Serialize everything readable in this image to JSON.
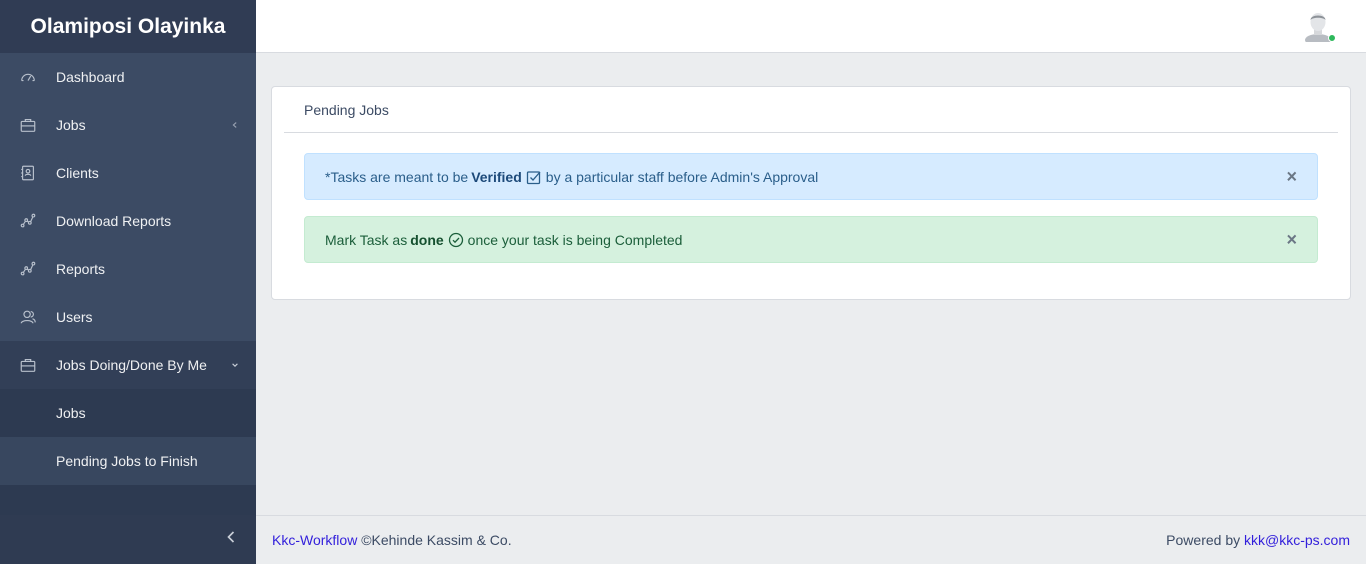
{
  "sidebar": {
    "brand": "Olamiposi Olayinka",
    "items": [
      {
        "label": "Dashboard",
        "icon": "speedometer-icon"
      },
      {
        "label": "Jobs",
        "icon": "briefcase-icon",
        "caret": "chevron-left-icon"
      },
      {
        "label": "Clients",
        "icon": "contact-icon"
      },
      {
        "label": "Download Reports",
        "icon": "chart-line-icon"
      },
      {
        "label": "Reports",
        "icon": "chart-line-icon"
      },
      {
        "label": "Users",
        "icon": "people-icon"
      },
      {
        "label": "Jobs Doing/Done By Me",
        "icon": "briefcase-icon",
        "caret": "chevron-down-icon"
      }
    ],
    "sub_items": [
      {
        "label": "Jobs"
      },
      {
        "label": "Pending Jobs to Finish",
        "active": true
      }
    ]
  },
  "card": {
    "title": "Pending Jobs",
    "alert_info": {
      "pre": "*Tasks are meant to be",
      "bold": "Verified",
      "post": "by a particular staff before Admin's Approval",
      "close": "×"
    },
    "alert_success": {
      "pre": "Mark Task as",
      "bold": "done",
      "post": "once your task is being Completed",
      "close": "×"
    }
  },
  "footer": {
    "brand_link": "Kkc-Workflow",
    "copyright": "©Kehinde Kassim & Co.",
    "powered_by": "Powered by",
    "email_link": "kkk@kkc-ps.com"
  },
  "colors": {
    "sidebar": "#3c4b64",
    "brand_bg": "#303c54",
    "link": "#321fdb",
    "online": "#2eb85c"
  }
}
